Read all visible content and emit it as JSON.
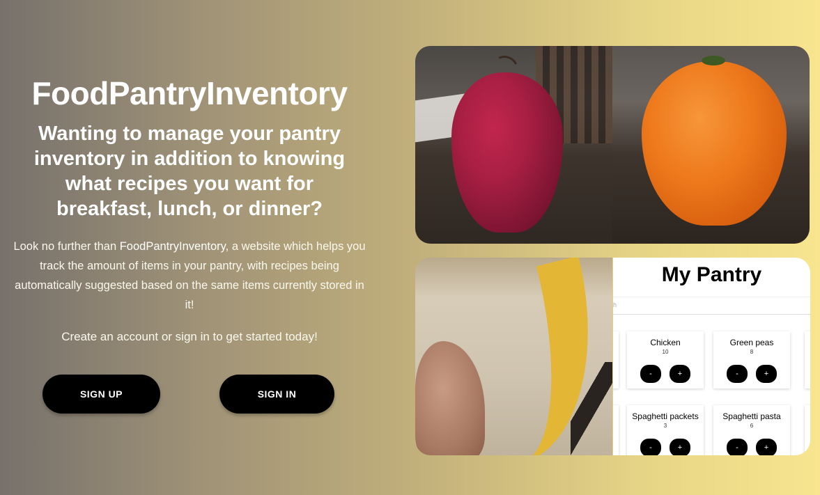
{
  "hero": {
    "title": "FoodPantryInventory",
    "subtitle": "Wanting to manage your pantry inventory in addition to knowing what recipes you want for breakfast, lunch, or dinner?",
    "body_prefix": "Look no further than ",
    "body_brand": "FoodPantryInventory",
    "body_suffix": ", a website which helps you track the amount of items in your pantry, with recipes being automatically suggested based on the same items currently stored in it!",
    "cta": "Create an account or sign in to get started today!"
  },
  "buttons": {
    "sign_up": "SIGN UP",
    "sign_in": "SIGN IN"
  },
  "gallery": {
    "pantry_preview": {
      "title": "My Pantry",
      "search_fragment": "h",
      "items": [
        {
          "name": "Chicken",
          "qty": "10"
        },
        {
          "name": "Green peas",
          "qty": "8"
        },
        {
          "name": "Spaghetti packets",
          "qty": "3"
        },
        {
          "name": "Spaghetti pasta",
          "qty": "6"
        }
      ],
      "minus_label": "-",
      "plus_label": "+"
    }
  },
  "colors": {
    "gradient_start": "#77716c",
    "gradient_end": "#f8e58f",
    "button_bg": "#000000",
    "button_text": "#ffffff"
  }
}
